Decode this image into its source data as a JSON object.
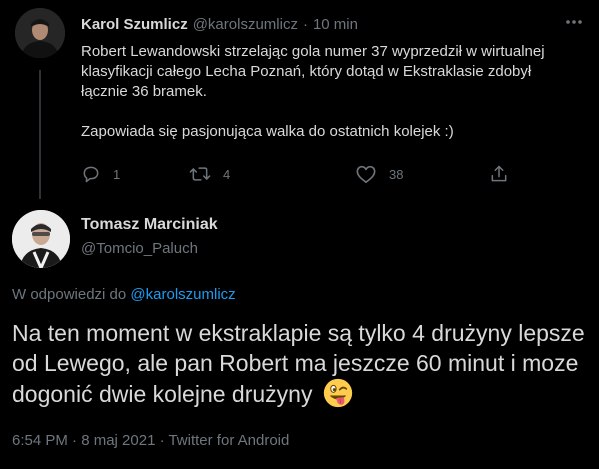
{
  "parent_tweet": {
    "author_name": "Karol Szumlicz",
    "author_handle": "@karolszumlicz",
    "separator": "·",
    "time": "10 min",
    "text_paragraph_1": "Robert Lewandowski strzelając gola numer 37 wyprzedził w wirtualnej klasyfikacji całego Lecha Poznań, który dotąd w Ekstraklasie zdobył łącznie 36 bramek.",
    "text_paragraph_2": "Zapowiada się pasjonująca walka do ostatnich kolejek :)",
    "reply_count": "1",
    "retweet_count": "4",
    "like_count": "38"
  },
  "reply_tweet": {
    "author_name": "Tomasz Marciniak",
    "author_handle": "@Tomcio_Paluch",
    "replying_prefix": "W odpowiedzi do",
    "replying_to": "@karolszumlicz",
    "text": "Na ten moment w ekstraklapie są tylko 4 drużyny lepsze od Lewego, ale pan Robert ma jeszcze 60 minut i moze dogonić dwie kolejne drużyny",
    "timestamp": "6:54 PM · 8 maj 2021 · Twitter for Android"
  },
  "colors": {
    "background": "#000000",
    "primary_text": "#d9d9d9",
    "secondary_text": "#6e767d",
    "link": "#1d9bf0",
    "thread_line": "#2f3336"
  },
  "icons": [
    "more-icon",
    "reply-icon",
    "retweet-icon",
    "like-icon",
    "share-icon",
    "winking-face-tongue-emoji"
  ]
}
